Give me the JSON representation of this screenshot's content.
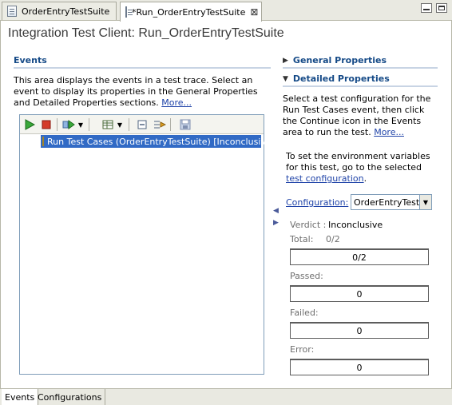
{
  "tabs": [
    {
      "label": "OrderEntryTestSuite",
      "active": false
    },
    {
      "label": "*Run_OrderEntryTestSuite",
      "active": true
    }
  ],
  "page_title": "Integration Test Client: Run_OrderEntryTestSuite",
  "events": {
    "heading": "Events",
    "description": "This area displays the events in a test trace. Select an event to display its properties in the General Properties and Detailed Properties sections.",
    "more_link": "More...",
    "tree_item": "Run Test Cases (OrderEntryTestSuite) [Inconclusive]"
  },
  "general_properties": {
    "heading": "General Properties"
  },
  "detailed_properties": {
    "heading": "Detailed Properties",
    "description": "Select a test configuration for the Run Test Cases event, then click the Continue icon in the Events area to run the test.",
    "more_link": "More...",
    "env_text": "To set the environment variables for this test, go to the selected",
    "env_link": "test configuration",
    "env_suffix": ".",
    "configuration_label": "Configuration:",
    "configuration_value": "OrderEntryTestS",
    "verdict_label": "Verdict :",
    "verdict_value": "Inconclusive",
    "total_label": "Total:",
    "total_value": "0/2",
    "total_box": "0/2",
    "passed_label": "Passed:",
    "passed_value": "0",
    "failed_label": "Failed:",
    "failed_value": "0",
    "error_label": "Error:",
    "error_value": "0"
  },
  "bottom_tabs": [
    {
      "label": "Events",
      "active": true
    },
    {
      "label": "Configurations",
      "active": false
    }
  ],
  "icons": {
    "run": "play-icon",
    "stop": "stop-icon",
    "step": "step-icon",
    "table": "table-icon",
    "collapse": "collapse-all-icon",
    "filter": "filter-icon",
    "save": "save-icon"
  },
  "colors": {
    "section_heading": "#154a87",
    "selection": "#316ac5",
    "link": "#1f43a8"
  }
}
